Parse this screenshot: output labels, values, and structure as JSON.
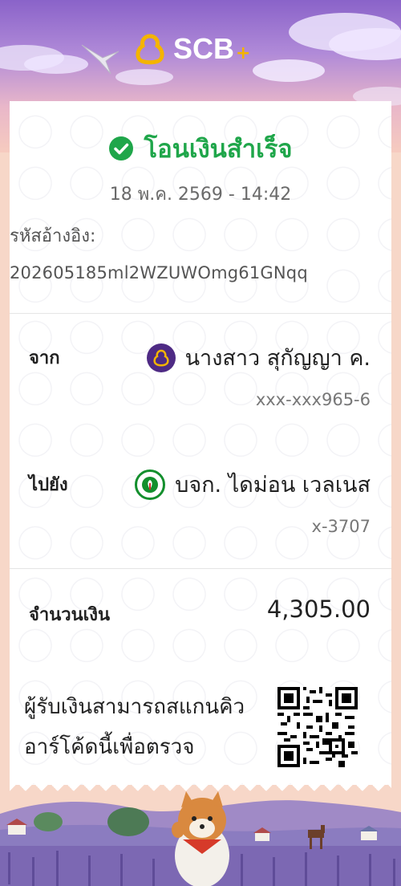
{
  "brand": {
    "logo_text": "SCB",
    "logo_plus": "+"
  },
  "receipt": {
    "status_title": "โอนเงินสำเร็จ",
    "datetime": "18 พ.ค. 2569 - 14:42",
    "reference_label": "รหัสอ้างอิง:",
    "reference_value": "202605185ml2WZUWOmg61GNqq",
    "from": {
      "label": "จาก",
      "name": "นางสาว สุกัญญา ค.",
      "account": "xxx-xxx965-6",
      "bank_icon": "scb-bank-icon"
    },
    "to": {
      "label": "ไปยัง",
      "name": "บจก. ไดม่อน เวลเนส",
      "account": "x-3707",
      "bank_icon": "kbank-icon"
    },
    "amount": {
      "label": "จำนวนเงิน",
      "value": "4,305.00"
    },
    "qr_note": "ผู้รับเงินสามารถสแกนคิวอาร์โค้ดนี้เพื่อตรวจ"
  },
  "colors": {
    "success_green": "#1fa64a",
    "scb_purple": "#4e2a84",
    "scb_gold": "#f4b400",
    "kbank_green": "#138f2d"
  }
}
